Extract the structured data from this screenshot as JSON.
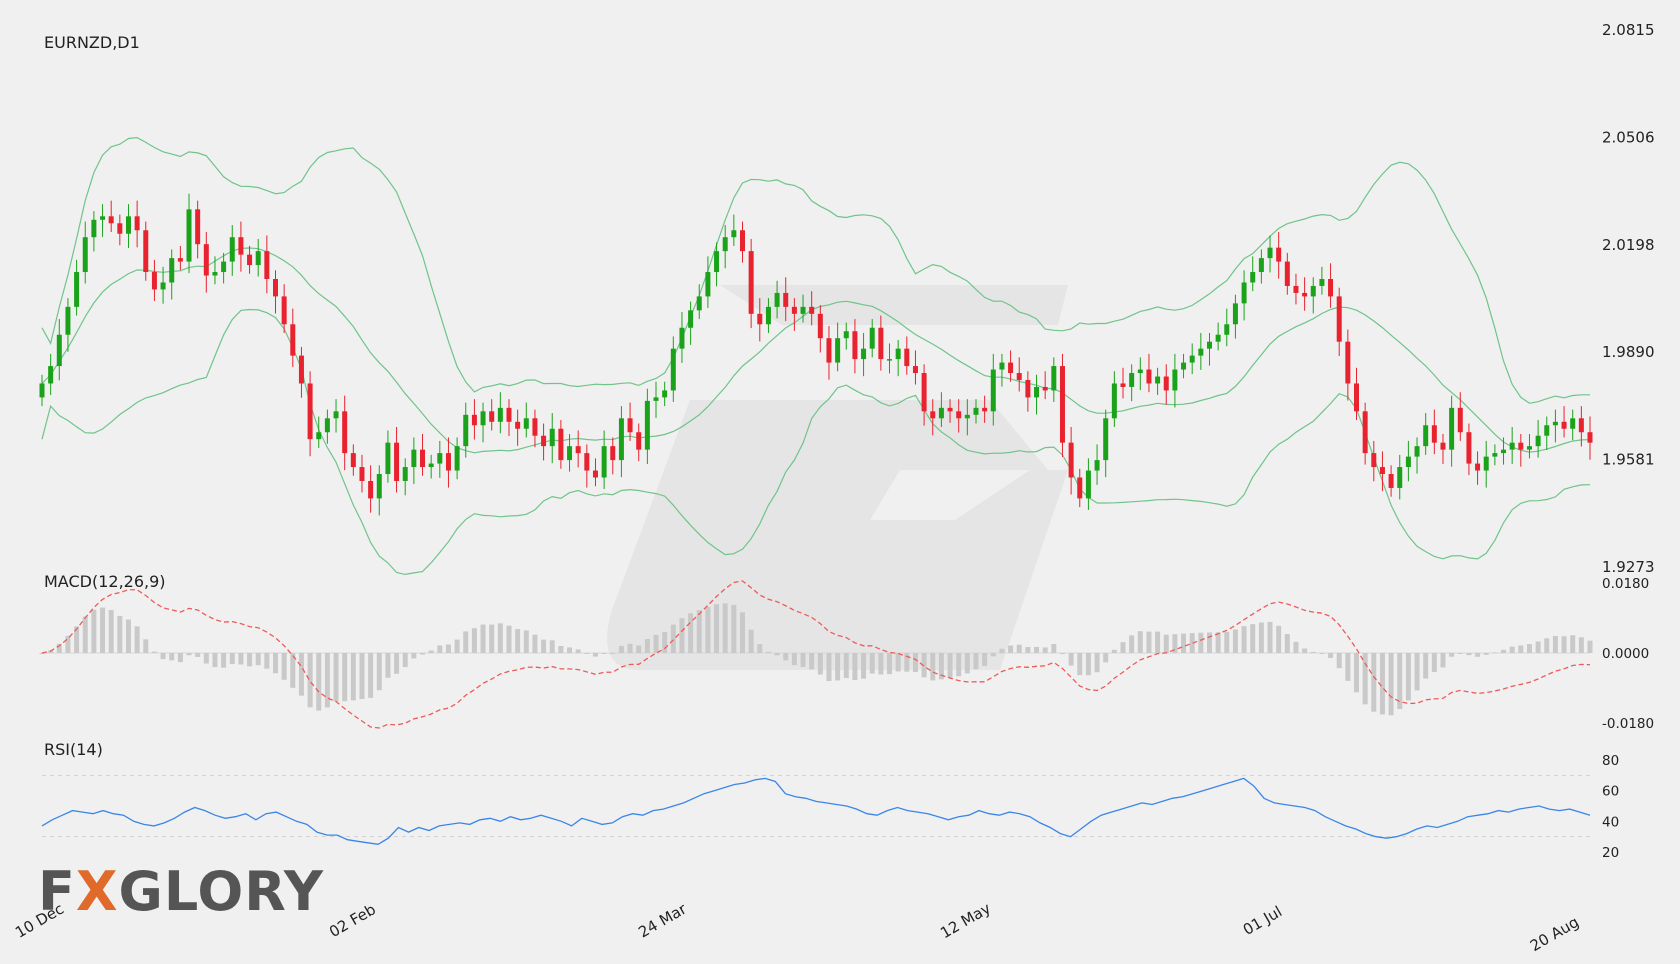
{
  "chart_data": [
    {
      "type": "candlestick",
      "title": "EURNZD,D1",
      "y_ticks": [
        "2.0815",
        "2.0506",
        "2.0198",
        "1.9890",
        "1.9581",
        "1.9273"
      ],
      "ylim": [
        1.9273,
        2.0815
      ],
      "x_tick_labels": [
        "10 Dec",
        "02 Feb",
        "24 Mar",
        "12 May",
        "01 Jul",
        "20 Aug"
      ],
      "indicators": [
        "Bollinger Bands"
      ],
      "colors": {
        "up": "#1aa31a",
        "down": "#e8222e",
        "bands": "#6fc48a"
      },
      "ohlc_close": [
        1.98,
        1.985,
        1.994,
        2.002,
        2.012,
        2.022,
        2.027,
        2.028,
        2.026,
        2.023,
        2.028,
        2.024,
        2.012,
        2.007,
        2.009,
        2.016,
        2.015,
        2.03,
        2.02,
        2.011,
        2.012,
        2.015,
        2.022,
        2.017,
        2.014,
        2.018,
        2.01,
        2.005,
        1.997,
        1.988,
        1.98,
        1.964,
        1.966,
        1.97,
        1.972,
        1.96,
        1.956,
        1.952,
        1.947,
        1.954,
        1.963,
        1.952,
        1.956,
        1.961,
        1.956,
        1.957,
        1.96,
        1.955,
        1.962,
        1.971,
        1.968,
        1.972,
        1.969,
        1.973,
        1.969,
        1.967,
        1.97,
        1.965,
        1.962,
        1.967,
        1.958,
        1.962,
        1.96,
        1.955,
        1.953,
        1.962,
        1.958,
        1.97,
        1.966,
        1.961,
        1.975,
        1.976,
        1.978,
        1.99,
        1.996,
        2.001,
        2.005,
        2.012,
        2.018,
        2.022,
        2.024,
        2.018,
        2.0,
        1.997,
        2.002,
        2.006,
        2.002,
        2.0,
        2.002,
        2.0,
        1.993,
        1.986,
        1.993,
        1.995,
        1.987,
        1.99,
        1.996,
        1.987,
        1.987,
        1.99,
        1.985,
        1.983,
        1.972,
        1.97,
        1.973,
        1.972,
        1.97,
        1.971,
        1.973,
        1.972,
        1.984,
        1.986,
        1.983,
        1.981,
        1.976,
        1.979,
        1.978,
        1.985,
        1.963,
        1.953,
        1.947,
        1.955,
        1.958,
        1.97,
        1.98,
        1.979,
        1.983,
        1.984,
        1.98,
        1.982,
        1.978,
        1.984,
        1.986,
        1.988,
        1.99,
        1.992,
        1.994,
        1.997,
        2.003,
        2.009,
        2.012,
        2.016,
        2.019,
        2.015,
        2.008,
        2.006,
        2.005,
        2.008,
        2.01,
        2.005,
        1.992,
        1.98,
        1.972,
        1.96,
        1.956,
        1.954,
        1.95,
        1.956,
        1.959,
        1.962,
        1.968,
        1.963,
        1.961,
        1.973,
        1.966,
        1.957,
        1.955,
        1.959,
        1.96,
        1.961,
        1.963,
        1.961,
        1.962,
        1.965,
        1.968,
        1.969,
        1.967,
        1.97,
        1.966,
        1.963
      ]
    },
    {
      "type": "bar",
      "title": "MACD(12,26,9)",
      "y_ticks": [
        "0.0180",
        "0.0000",
        "-0.0180"
      ],
      "ylim": [
        -0.018,
        0.018
      ],
      "series": [
        {
          "name": "",
          "kind": "histogram",
          "color": "#c9c9c9"
        },
        {
          "name": "",
          "kind": "signal",
          "color": "#ec5b5b"
        }
      ]
    },
    {
      "type": "line",
      "title": "RSI(14)",
      "y_ticks": [
        "80",
        "60",
        "40",
        "20"
      ],
      "ylim": [
        20,
        80
      ],
      "levels": [
        70,
        30
      ],
      "color": "#3a86e8",
      "values": [
        37,
        41,
        44,
        47,
        46,
        45,
        47,
        45,
        44,
        40,
        38,
        37,
        39,
        42,
        46,
        49,
        47,
        44,
        42,
        43,
        45,
        41,
        45,
        46,
        43,
        40,
        38,
        33,
        31,
        31,
        28,
        27,
        26,
        25,
        29,
        36,
        33,
        36,
        34,
        37,
        38,
        39,
        38,
        41,
        42,
        40,
        43,
        41,
        42,
        44,
        42,
        40,
        37,
        42,
        40,
        38,
        39,
        43,
        45,
        44,
        47,
        48,
        50,
        52,
        55,
        58,
        60,
        62,
        64,
        65,
        67,
        68,
        66,
        58,
        56,
        55,
        53,
        52,
        51,
        50,
        48,
        45,
        44,
        47,
        49,
        47,
        46,
        45,
        43,
        41,
        43,
        44,
        47,
        45,
        44,
        46,
        45,
        43,
        39,
        36,
        32,
        30,
        35,
        40,
        44,
        46,
        48,
        50,
        52,
        51,
        53,
        55,
        56,
        58,
        60,
        62,
        64,
        66,
        68,
        63,
        55,
        52,
        51,
        50,
        49,
        47,
        43,
        40,
        37,
        35,
        32,
        30,
        29,
        30,
        32,
        35,
        37,
        36,
        38,
        40,
        43,
        44,
        45,
        47,
        46,
        48,
        49,
        50,
        48,
        47,
        48,
        46,
        44
      ]
    }
  ],
  "brand": {
    "text_left": "F",
    "text_accent": "X",
    "text_right": "GLORY"
  }
}
